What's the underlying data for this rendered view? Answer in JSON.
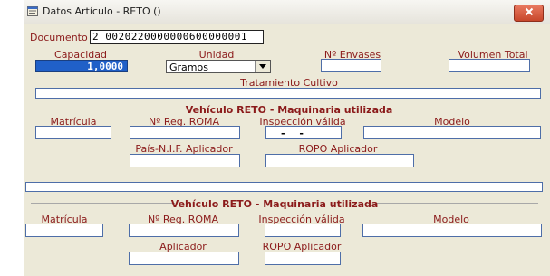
{
  "window": {
    "title": "Datos Artículo - RETO ()",
    "icon": "form-icon",
    "close_icon": "close-icon"
  },
  "colors": {
    "label": "#8b1a1a",
    "field_border": "#4e6ea8",
    "selected_field_bg": "#2060c8",
    "close_button": "#c7472b"
  },
  "documento": {
    "label": "Documento",
    "value": "2  0020220000000600000001"
  },
  "headers": {
    "capacidad": "Capacidad",
    "unidad": "Unidad",
    "n_envases": "Nº Envases",
    "volumen_total": "Volumen Total"
  },
  "values": {
    "capacidad": "1,0000",
    "unidad": "Gramos",
    "n_envases": "",
    "volumen_total": ""
  },
  "tratamiento": {
    "label": "Tratamiento Cultivo",
    "value": ""
  },
  "section1": {
    "title": "Vehículo RETO - Maquinaria utilizada",
    "matricula": "Matrícula",
    "reg_roma": "Nº Reg. ROMA",
    "inspeccion": "Inspección válida",
    "inspeccion_value": "-  -",
    "modelo": "Modelo",
    "pais_nif": "País-N.I.F. Aplicador",
    "ropo": "ROPO Aplicador"
  },
  "section2": {
    "title": "Vehículo RETO - Maquinaria utilizada",
    "matricula": "Matrícula",
    "reg_roma": "Nº Reg. ROMA",
    "inspeccion": "Inspección válida",
    "modelo": "Modelo",
    "aplicador": "Aplicador",
    "ropo": "ROPO Aplicador"
  }
}
